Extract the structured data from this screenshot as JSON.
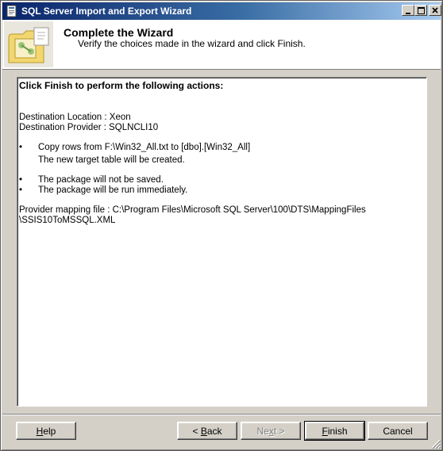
{
  "window": {
    "title": "SQL Server Import and Export Wizard",
    "controls": [
      "minimize",
      "maximize",
      "close"
    ]
  },
  "header": {
    "title": "Complete the Wizard",
    "subtitle": "Verify the choices made in the wizard and click Finish."
  },
  "summary": {
    "heading": "Click Finish to perform the following actions:",
    "destination_location": "Destination Location : Xeon",
    "destination_provider": "Destination Provider : SQLNCLI10",
    "bullets": [
      {
        "text": "Copy rows from F:\\Win32_All.txt to [dbo].[Win32_All]",
        "sub": "The new target table will be created."
      },
      {
        "text": "The package will not be saved."
      },
      {
        "text": "The package will be run immediately."
      }
    ],
    "mapping_line1": "Provider mapping file : C:\\Program Files\\Microsoft SQL Server\\100\\DTS\\MappingFiles",
    "mapping_line2": "\\SSIS10ToMSSQL.XML",
    "bullet_char": "•"
  },
  "buttons": {
    "help_mnemonic": "H",
    "help_rest": "elp",
    "back_prefix": "< ",
    "back_mnemonic": "B",
    "back_rest": "ack",
    "next_prefix": "Ne",
    "next_mnemonic": "x",
    "next_rest": "t >",
    "finish_mnemonic": "F",
    "finish_rest": "inish",
    "cancel": "Cancel"
  },
  "colors": {
    "title_gradient_start": "#0a246a",
    "title_gradient_end": "#a6caf0",
    "face": "#d4d0c8"
  }
}
